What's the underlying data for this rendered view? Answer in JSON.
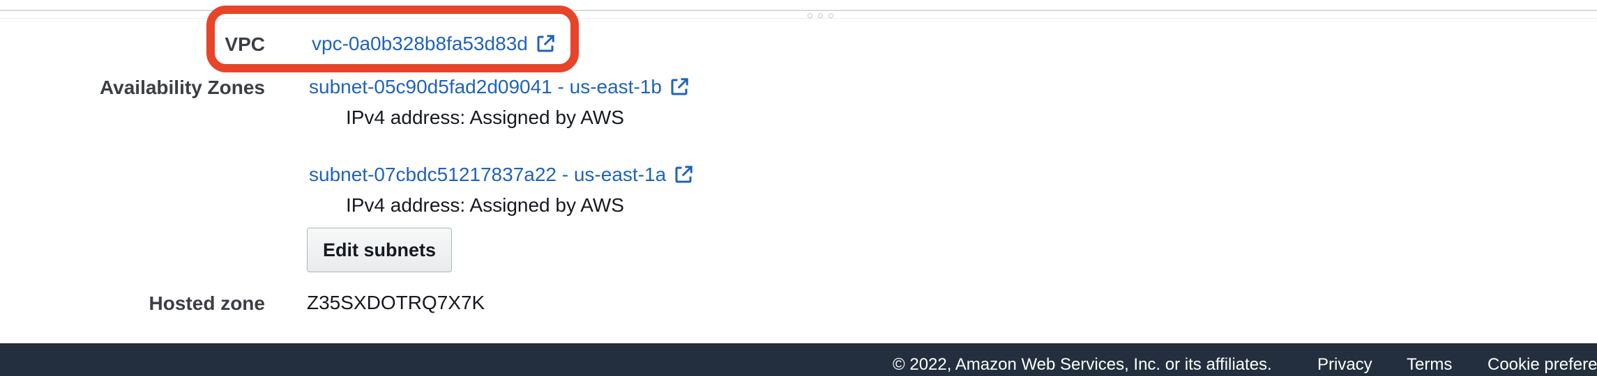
{
  "details": {
    "vpc": {
      "label": "VPC",
      "value": "vpc-0a0b328b8fa53d83d"
    },
    "availability_zones": {
      "label": "Availability Zones",
      "subnets": [
        {
          "link": "subnet-05c90d5fad2d09041 - us-east-1b",
          "ipv4": "IPv4 address: Assigned by AWS"
        },
        {
          "link": "subnet-07cbdc51217837a22 - us-east-1a",
          "ipv4": "IPv4 address: Assigned by AWS"
        }
      ],
      "edit_button": "Edit subnets"
    },
    "hosted_zone": {
      "label": "Hosted zone",
      "value": "Z35SXDOTRQ7X7K"
    }
  },
  "footer": {
    "copyright": "© 2022, Amazon Web Services, Inc. or its affiliates.",
    "privacy": "Privacy",
    "terms": "Terms",
    "cookie": "Cookie prefere"
  },
  "colors": {
    "link": "#1f63b9",
    "highlight": "#e8442a",
    "footer_bg": "#232f3e"
  },
  "icons": {
    "external_link": "external-link-icon"
  }
}
